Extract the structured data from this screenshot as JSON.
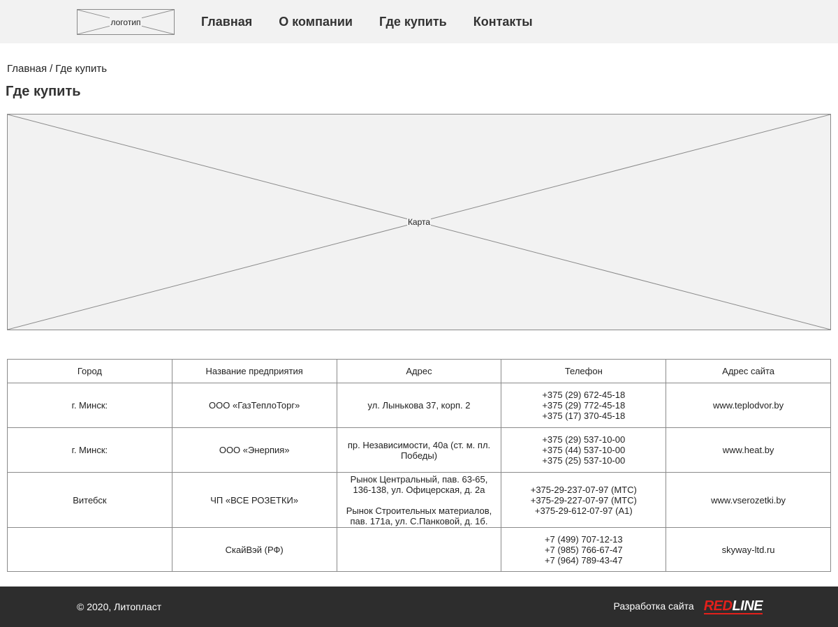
{
  "header": {
    "logo_label": "логотип",
    "nav": [
      {
        "label": "Главная"
      },
      {
        "label": "О компании"
      },
      {
        "label": "Где купить"
      },
      {
        "label": "Контакты"
      }
    ]
  },
  "breadcrumb": {
    "home": "Главная",
    "separator": "/",
    "current": "Где купить"
  },
  "page_title": "Где купить",
  "map": {
    "label": "Карта"
  },
  "table": {
    "headers": [
      "Город",
      "Название предприятия",
      "Адрес",
      "Телефон",
      "Адрес сайта"
    ],
    "rows": [
      {
        "city": "г. Минск:",
        "company": "ООО «ГазТеплоТорг»",
        "address": [
          "ул. Лынькова 37, корп. 2"
        ],
        "phones": [
          "+375 (29) 672-45-18",
          "+375 (29) 772-45-18",
          "+375 (17) 370-45-18"
        ],
        "site": "www.teplodvor.by"
      },
      {
        "city": "г. Минск:",
        "company": "ООО «Энерпия»",
        "address": [
          "пр. Независимости, 40а (ст. м. пл.",
          "Победы)"
        ],
        "phones": [
          "+375 (29) 537-10-00",
          "+375 (44) 537-10-00",
          "+375 (25) 537-10-00"
        ],
        "site": "www.heat.by"
      },
      {
        "city": "Витебск",
        "company": "ЧП «ВСЕ РОЗЕТКИ»",
        "address_block_1": [
          "Рынок Центральный, пав. 63-65,",
          "136-138, ул. Офицерская, д. 2а"
        ],
        "address_block_2": [
          "Рынок Строительных материалов,",
          "пав. 171а, ул. С.Панковой, д. 1б."
        ],
        "phones": [
          "+375-29-237-07-97 (МТС)",
          "+375-29-227-07-97 (МТС)",
          "+375-29-612-07-97 (А1)"
        ],
        "site": "www.vserozetki.by"
      },
      {
        "city": "",
        "company": "СкайВэй (РФ)",
        "address": [],
        "phones": [
          "+7 (499) 707-12-13",
          "+7 (985) 766-67-47",
          "+7 (964) 789-43-47"
        ],
        "site": "skyway-ltd.ru"
      }
    ]
  },
  "footer": {
    "copyright": "© 2020, Литопласт",
    "dev_label": "Разработка сайта",
    "dev_logo_red": "RED",
    "dev_logo_white": "LINE"
  },
  "colors": {
    "header_bg": "#f2f2f2",
    "footer_bg": "#2d2d2d",
    "accent_red": "#e3201b",
    "border_gray": "#8a8a8a"
  }
}
